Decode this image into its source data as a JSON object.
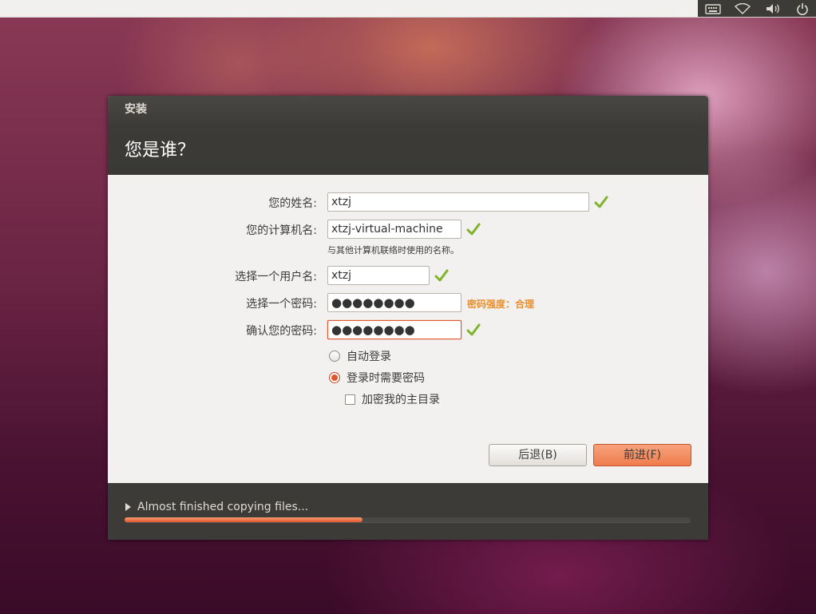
{
  "panel": {
    "indicators": [
      "keyboard-icon",
      "wifi-icon",
      "volume-icon",
      "power-icon"
    ]
  },
  "window": {
    "title": "安装",
    "heading": "您是谁？"
  },
  "form": {
    "name_label": "您的姓名:",
    "name_value": "xtzj",
    "computer_label": "您的计算机名:",
    "computer_value": "xtzj-virtual-machine",
    "computer_hint": "与其他计算机联络时使用的名称。",
    "username_label": "选择一个用户名:",
    "username_value": "xtzj",
    "password_label": "选择一个密码:",
    "password_value": "●●●●●●●●",
    "password_strength": "密码强度：合理",
    "confirm_label": "确认您的密码:",
    "confirm_value": "●●●●●●●●",
    "option_autologin": "自动登录",
    "option_require_password": "登录时需要密码",
    "option_encrypt_home": "加密我的主目录",
    "selected_option": "option_require_password",
    "encrypt_home_checked": false
  },
  "buttons": {
    "back": "后退(B)",
    "next": "前进(F)"
  },
  "footer": {
    "status": "Almost finished copying files...",
    "progress": 0.42
  },
  "colors": {
    "accent": "#e2562c",
    "header_bg": "#3c3b37",
    "check_green": "#7fb32a",
    "strength_orange": "#e98f2d"
  }
}
